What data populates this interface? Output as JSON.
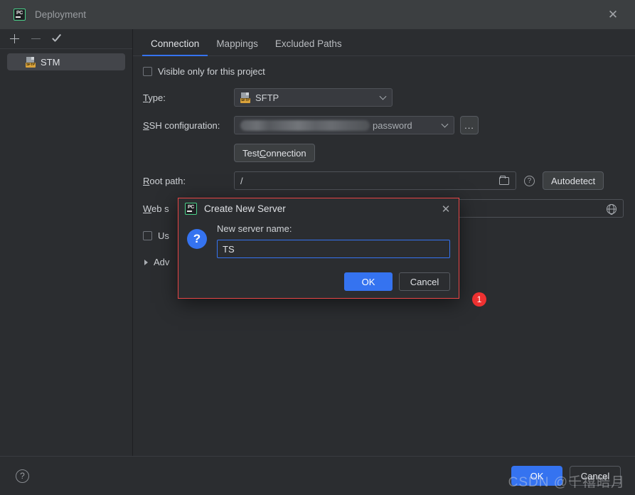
{
  "window": {
    "title": "Deployment",
    "app_icon": "pycharm-icon",
    "close_icon": "close-icon"
  },
  "sidebar": {
    "toolbar": [
      {
        "name": "add-server-button",
        "icon": "plus-icon",
        "enabled": true
      },
      {
        "name": "remove-server-button",
        "icon": "minus-icon",
        "enabled": false
      },
      {
        "name": "set-default-server-button",
        "icon": "check-icon",
        "enabled": true
      }
    ],
    "servers": [
      {
        "label": "STM",
        "icon": "sftp-icon",
        "icon_tag": "SFTP",
        "selected": true
      }
    ]
  },
  "tabs": [
    {
      "label": "Connection",
      "active": true
    },
    {
      "label": "Mappings",
      "active": false
    },
    {
      "label": "Excluded Paths",
      "active": false
    }
  ],
  "form": {
    "visible_only_checkbox": {
      "label": "Visible only for this project",
      "checked": false
    },
    "type": {
      "label": "Type:",
      "mnemonic": "T",
      "label_rest": "ype:",
      "value": "SFTP",
      "icon": "sftp-icon",
      "icon_tag": "SFTP"
    },
    "ssh_configuration": {
      "mnemonic": "S",
      "label_rest": "SH configuration:",
      "value_redacted": true,
      "value_suffix": "password",
      "browse_button": "..."
    },
    "test_connection": {
      "label_pre": "Test ",
      "mnemonic": "C",
      "label_post": "onnection"
    },
    "root_path": {
      "mnemonic": "R",
      "label_rest": "oot path:",
      "value": "/",
      "folder_icon": "folder-icon",
      "help_icon": "help-icon",
      "autodetect_label": "Autodetect"
    },
    "web_server_url": {
      "mnemonic": "W",
      "label_rest": "eb s",
      "label_full": "Web server URL:",
      "value": "",
      "globe_icon": "globe-icon"
    },
    "use_checkbox": {
      "label_visible": "Us",
      "checked": false
    },
    "advanced": {
      "label_visible": "Adv",
      "expanded": false
    }
  },
  "annotation_badge": {
    "text": "1",
    "color": "#f03232"
  },
  "modal": {
    "title": "Create New Server",
    "app_icon": "pycharm-icon",
    "close_icon": "close-icon",
    "info_icon": "question-icon",
    "field_label": "New server name:",
    "field_value": "TS",
    "ok_label": "OK",
    "cancel_label": "Cancel",
    "border_color": "#e94646"
  },
  "footer": {
    "help_icon": "help-icon",
    "ok_label": "OK",
    "cancel_label": "Cancel",
    "watermark": "CSDN @千禧皓月"
  },
  "colors": {
    "accent": "#3573f0",
    "background": "#2b2d30",
    "titlebar": "#3c3f41",
    "badge": "#f03232",
    "modal_border": "#e94646",
    "sftp_tag": "#d9a23b"
  }
}
